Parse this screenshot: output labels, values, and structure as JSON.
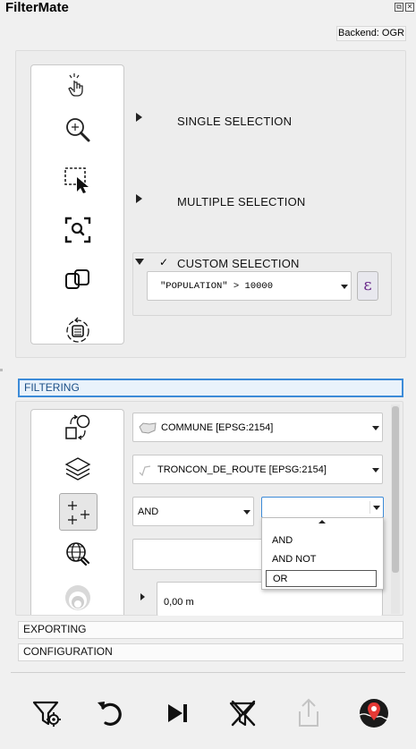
{
  "window": {
    "title": "FilterMate",
    "float_btn": "⧉",
    "close_btn": "✕"
  },
  "backend": {
    "label": "Backend: OGR"
  },
  "selection_tools": [
    {
      "icon": "pointer-hand-icon"
    },
    {
      "icon": "zoom-in-icon"
    },
    {
      "icon": "select-rectangle-icon"
    },
    {
      "icon": "zoom-selection-icon"
    },
    {
      "icon": "duplicate-layers-icon"
    },
    {
      "icon": "layer-refresh-icon"
    }
  ],
  "selection": {
    "single_label": "SINGLE SELECTION",
    "multiple_label": "MULTIPLE SELECTION",
    "custom_check": "✓",
    "custom_label": "CUSTOM SELECTION",
    "expression_value": "\"POPULATION\" > 10000",
    "epsilon_btn": "ε"
  },
  "sections": {
    "filtering": "FILTERING",
    "exporting": "EXPORTING",
    "configuration": "CONFIGURATION"
  },
  "filtering": {
    "source_layer": "COMMUNE [EPSG:2154]",
    "target_layer": "TRONCON_DE_ROUTE [EPSG:2154]",
    "operator_value": "AND",
    "combine_value": "",
    "combine_options": [
      "AND",
      "AND NOT",
      "OR"
    ],
    "combine_highlight": "OR",
    "buffer_value": "0,00 m"
  },
  "bottom_toolbar": [
    {
      "icon": "filter-settings-icon"
    },
    {
      "icon": "undo-icon"
    },
    {
      "icon": "skip-next-icon"
    },
    {
      "icon": "clear-filter-icon"
    },
    {
      "icon": "export-icon"
    },
    {
      "icon": "map-pin-icon"
    }
  ],
  "colors": {
    "accent": "#3c8bd8",
    "pin_red": "#e53935",
    "dark": "#1a1a1a"
  }
}
